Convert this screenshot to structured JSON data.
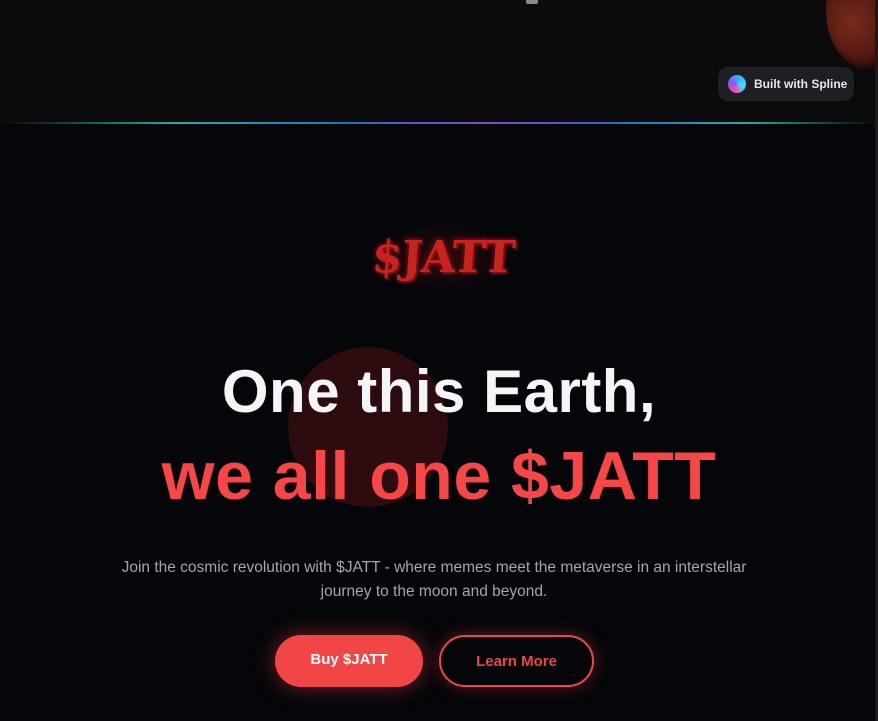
{
  "top": {
    "spline_badge_label": "Built with Spline"
  },
  "logo": {
    "text": "$JATT"
  },
  "hero": {
    "headline_line1": "One this Earth,",
    "headline_line2": "we all one $JATT",
    "subtitle": "Join the cosmic revolution with $JATT - where memes meet the metaverse in an interstellar journey to the moon and beyond."
  },
  "actions": {
    "buy_label": "Buy $JATT",
    "learn_label": "Learn More"
  },
  "colors": {
    "accent": "#f24545",
    "background": "#05060a",
    "headline_white": "#f5f5f7"
  }
}
